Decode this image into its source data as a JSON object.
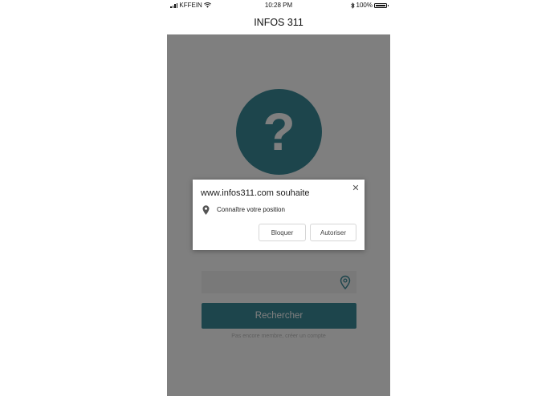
{
  "status_bar": {
    "carrier": "KFFEIN",
    "time": "10:28 PM",
    "battery": "100%"
  },
  "nav": {
    "title": "INFOS 311"
  },
  "main": {
    "logo_glyph": "?",
    "address_input": {
      "value": "",
      "placeholder": ""
    },
    "locate_icon": "location-pin-icon",
    "search_label": "Rechercher",
    "signup_text": "Pas encore membre, créer un compte"
  },
  "dialog": {
    "title": "www.infos311.com souhaite",
    "close_glyph": "✕",
    "permission_icon": "location-pin-icon",
    "permission_label": "Connaître votre position",
    "block_label": "Bloquer",
    "allow_label": "Autoriser"
  },
  "colors": {
    "accent": "#3a8a98",
    "overlay": "rgba(0,0,0,0.5)",
    "background": "#ffffff"
  }
}
